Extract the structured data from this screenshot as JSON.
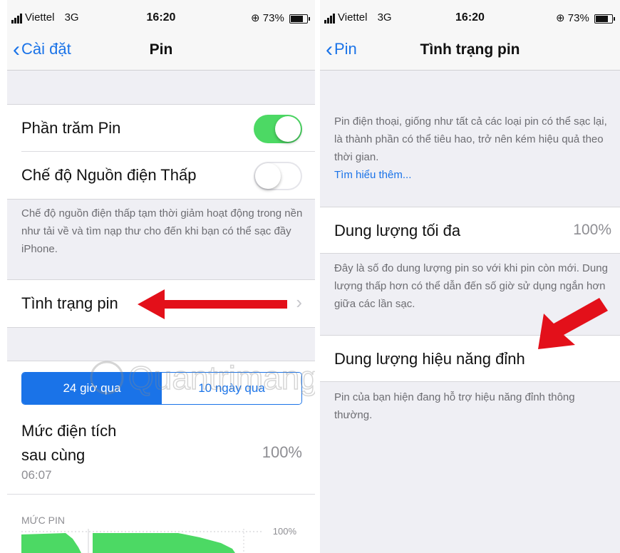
{
  "left": {
    "status": {
      "carrier": "Viettel",
      "network": "3G",
      "time": "16:20",
      "battery": "73%"
    },
    "nav": {
      "back": "Cài đặt",
      "title": "Pin"
    },
    "battery_percentage": {
      "label": "Phần trăm Pin",
      "on": true
    },
    "low_power": {
      "label": "Chế độ Nguồn điện Thấp",
      "on": false
    },
    "low_power_note": "Chế độ nguồn điện thấp tạm thời giảm hoạt động trong nền như tải về và tìm nạp thư cho đến khi bạn có thể sạc đầy iPhone.",
    "battery_health": {
      "label": "Tình trạng pin"
    },
    "segments": {
      "active": "24 giờ qua",
      "inactive": "10 ngày qua"
    },
    "last_charge": {
      "label_line1": "Mức điện tích",
      "label_line2": "sau cùng",
      "value": "100%",
      "time": "06:07"
    },
    "battery_level": {
      "header": "MỨC PIN",
      "axis_label": "100%"
    }
  },
  "right": {
    "status": {
      "carrier": "Viettel",
      "network": "3G",
      "time": "16:20",
      "battery": "73%"
    },
    "nav": {
      "back": "Pin",
      "title": "Tình trạng pin"
    },
    "intro": "Pin điện thoại, giống như tất cả các loại pin có thể sạc lại, là thành phần có thể tiêu hao, trở nên kém hiệu quả theo thời gian.",
    "learn_more": "Tìm hiểu thêm...",
    "max_capacity": {
      "label": "Dung lượng tối đa",
      "value": "100%"
    },
    "max_capacity_note": "Đây là số đo dung lượng pin so với khi pin còn mới. Dung lượng thấp hơn có thể dẫn đến số giờ sử dụng ngắn hơn giữa các lần sạc.",
    "peak_performance": {
      "label": "Dung lượng hiệu năng đỉnh"
    },
    "peak_note": "Pin của bạn hiện đang hỗ trợ hiệu năng đỉnh thông thường."
  },
  "colors": {
    "accent": "#1a73e8",
    "toggle_on": "#4cd964",
    "annotation_arrow": "#e3101a",
    "chart_green": "#4cd964"
  },
  "icons": {
    "back": "chevron-left-icon",
    "disclosure": "chevron-right-icon",
    "arrow": "red-arrow-icon"
  },
  "watermark": "Quantrimang"
}
